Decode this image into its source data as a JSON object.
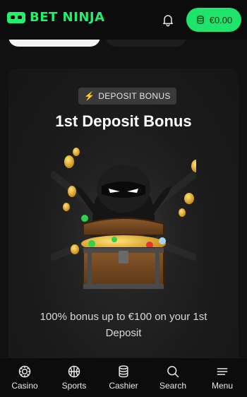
{
  "header": {
    "logo_text": "BET NINJA",
    "balance": "€0.00",
    "accent_color": "#1ff26a"
  },
  "promo": {
    "badge": "DEPOSIT BONUS",
    "badge_icon": "lightning-icon",
    "title": "1st Deposit Bonus",
    "description": "100% bonus up to €100 on your 1st Deposit"
  },
  "bottom_nav": [
    {
      "label": "Casino",
      "icon": "casino-chip-icon"
    },
    {
      "label": "Sports",
      "icon": "basketball-icon"
    },
    {
      "label": "Cashier",
      "icon": "coins-stack-icon"
    },
    {
      "label": "Search",
      "icon": "search-icon"
    },
    {
      "label": "Menu",
      "icon": "hamburger-icon"
    }
  ]
}
